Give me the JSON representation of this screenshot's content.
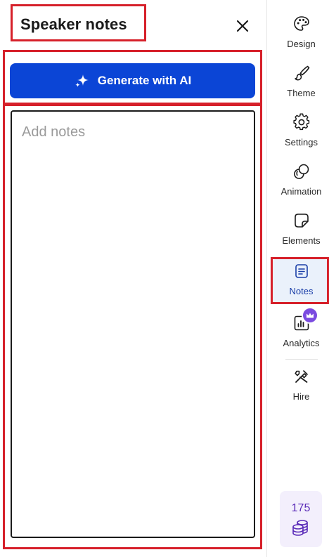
{
  "panel": {
    "title": "Speaker notes",
    "generate_label": "Generate with AI",
    "notes_placeholder": "Add notes",
    "notes_value": ""
  },
  "rail": {
    "items": [
      {
        "label": "Design",
        "icon": "palette-icon"
      },
      {
        "label": "Theme",
        "icon": "brush-icon"
      },
      {
        "label": "Settings",
        "icon": "gear-icon"
      },
      {
        "label": "Animation",
        "icon": "animation-icon"
      },
      {
        "label": "Elements",
        "icon": "sticker-icon"
      },
      {
        "label": "Notes",
        "icon": "notes-icon",
        "active": true
      },
      {
        "label": "Analytics",
        "icon": "chart-icon",
        "premium": true
      },
      {
        "label": "Hire",
        "icon": "tools-icon"
      }
    ],
    "credits": "175"
  },
  "colors": {
    "accent": "#0b45d6",
    "highlight": "#d6202a",
    "premium": "#7b4be0"
  }
}
